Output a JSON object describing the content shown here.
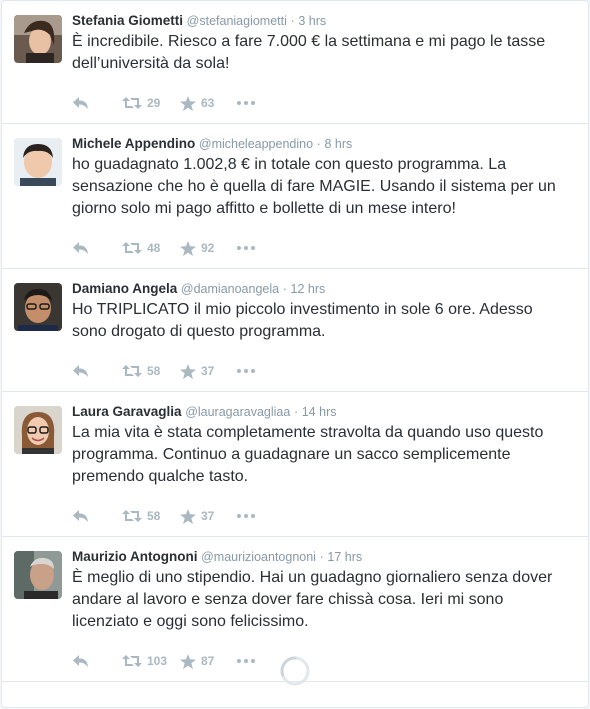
{
  "tweets": [
    {
      "fullname": "Stefania Giometti",
      "username": "@stefaniagiometti",
      "time": "3 hrs",
      "text": "È incredibile. Riesco a fare 7.000 € la settimana e mi pago le tasse dell’università da sola!",
      "retweets": "29",
      "favorites": "63"
    },
    {
      "fullname": "Michele Appendino",
      "username": "@micheleappendino",
      "time": "8 hrs",
      "text": "ho guadagnato 1.002,8 € in totale con questo programma. La sensazione che ho è quella di fare MAGIE. Usando il sistema per un giorno solo mi pago affitto e bollette di un mese intero!",
      "retweets": "48",
      "favorites": "92"
    },
    {
      "fullname": "Damiano Angela",
      "username": "@damianoangela",
      "time": "12 hrs",
      "text": "Ho TRIPLICATO il mio piccolo investimento in sole 6 ore. Adesso sono drogato di questo programma.",
      "retweets": "58",
      "favorites": "37"
    },
    {
      "fullname": "Laura Garavaglia",
      "username": "@lauragaravagliaa",
      "time": "14 hrs",
      "text": "La mia vita è stata completamente stravolta da quando uso questo programma. Continuo a guadagnare un sacco semplicemente premendo qualche tasto.",
      "retweets": "58",
      "favorites": "37"
    },
    {
      "fullname": "Maurizio Antognoni",
      "username": "@maurizioantognoni",
      "time": "17 hrs",
      "text": "È meglio di uno stipendio. Hai un guadagno giornaliero senza dover andare al lavoro e senza dover fare chissà cosa. Ieri mi sono licenziato e oggi sono felicissimo.",
      "retweets": "103",
      "favorites": "87"
    }
  ],
  "separator": "·",
  "colors": {
    "text": "#292f33",
    "muted": "#8899a6",
    "icon": "#aab8c2",
    "border": "#e1e8ed"
  }
}
